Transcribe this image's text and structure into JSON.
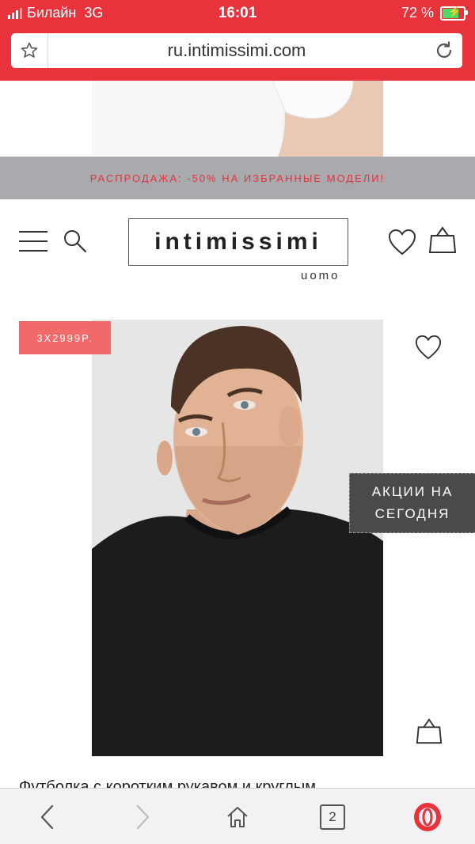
{
  "status_bar": {
    "carrier": "Билайн",
    "network": "3G",
    "time": "16:01",
    "battery_percent": "72 %"
  },
  "browser": {
    "url": "ru.intimissimi.com",
    "tab_count": "2"
  },
  "promo_banner": {
    "text": "РАСПРОДАЖА: -50% НА ИЗБРАННЫЕ МОДЕЛИ!"
  },
  "header": {
    "logo_text": "intimissimi",
    "logo_sub": "uomo"
  },
  "product": {
    "badge": "3X2999P.",
    "title": "Футболка с коротким рукавом и круглым"
  },
  "deals_tab": {
    "line1": "АКЦИИ НА",
    "line2": "СЕГОДНЯ"
  },
  "colors": {
    "brand_red": "#e8323c",
    "badge_red": "#f06a6a",
    "promo_gray": "#a8aaad"
  }
}
